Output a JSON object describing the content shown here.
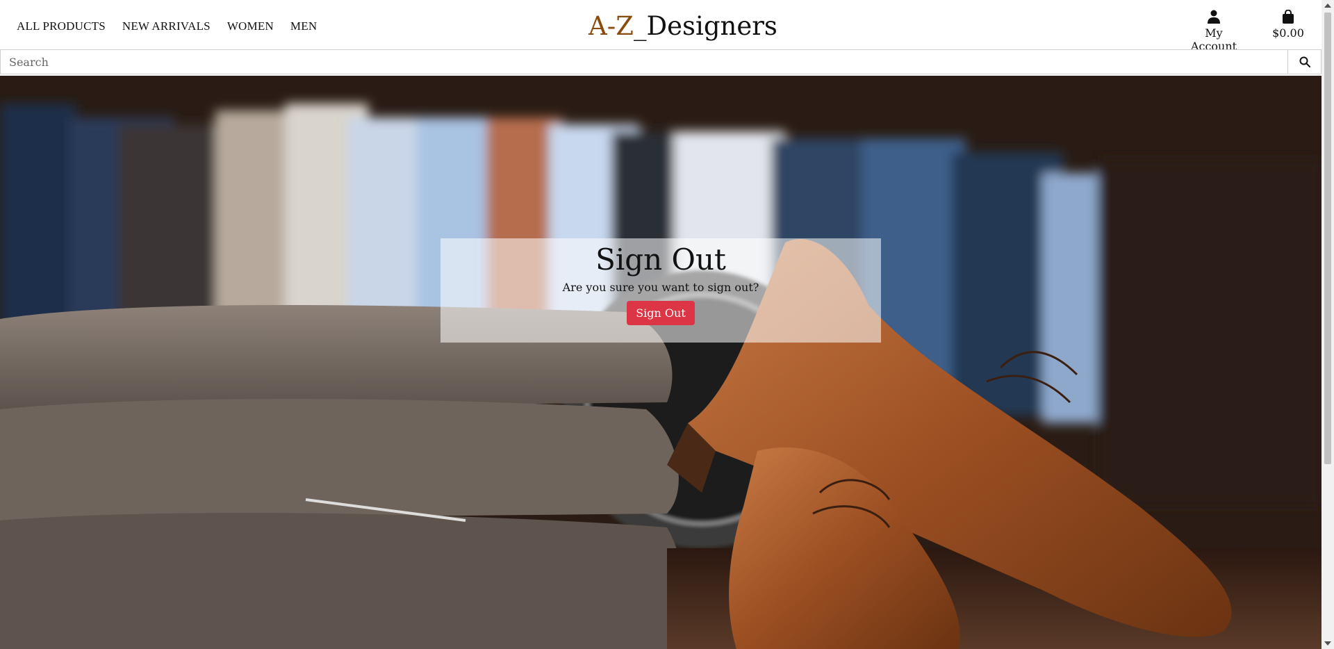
{
  "nav": {
    "items": [
      {
        "label": "ALL PRODUCTS"
      },
      {
        "label": "NEW ARRIVALS"
      },
      {
        "label": "WOMEN"
      },
      {
        "label": "MEN"
      }
    ]
  },
  "brand": {
    "prefix": "A-Z",
    "suffix": "_Designers",
    "prefix_color": "#8a4b0f"
  },
  "account": {
    "label": "My Account",
    "icon": "user-icon"
  },
  "cart": {
    "total": "$0.00",
    "icon": "shopping-bag-icon"
  },
  "search": {
    "placeholder": "Search",
    "value": "",
    "icon": "search-icon"
  },
  "signout": {
    "title": "Sign Out",
    "message": "Are you sure you want to sign out?",
    "button_label": "Sign Out",
    "button_color": "#dc3545"
  }
}
